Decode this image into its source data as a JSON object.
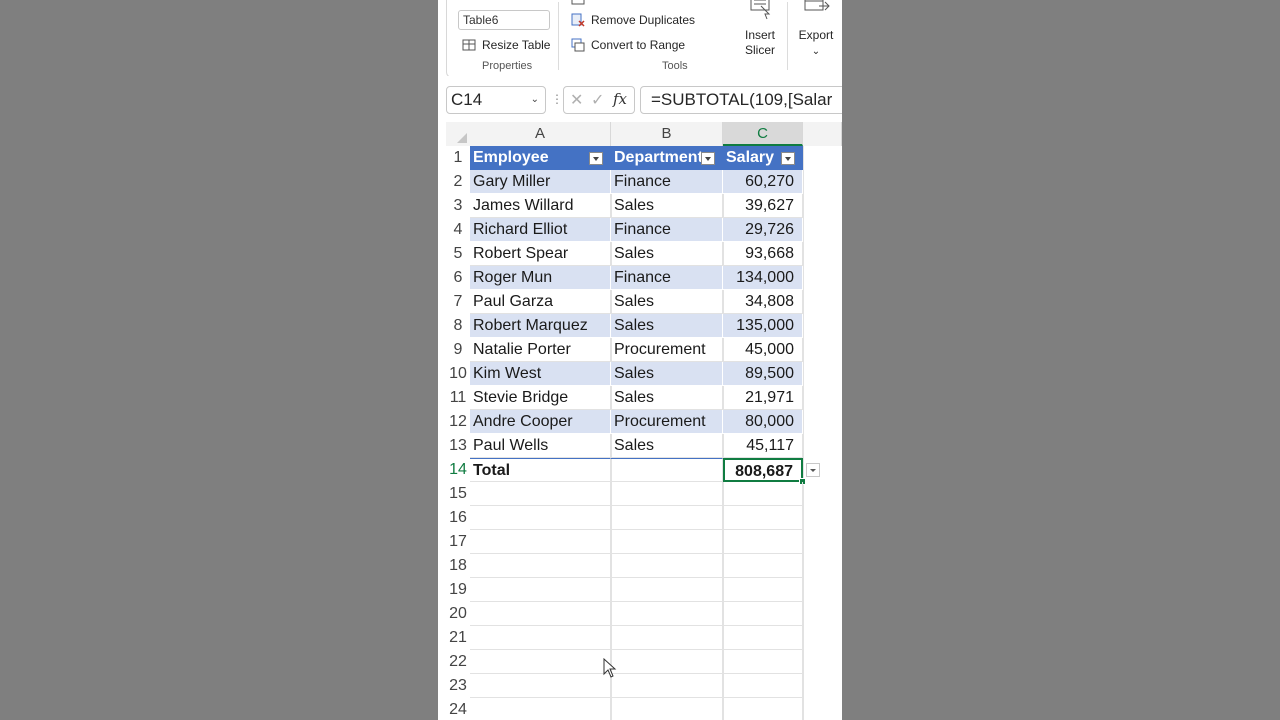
{
  "ribbon": {
    "table_name": "Table6",
    "resize_table": "Resize Table",
    "properties_group": "Properties",
    "remove_duplicates": "Remove Duplicates",
    "convert_to_range": "Convert to Range",
    "tools_group": "Tools",
    "insert_slicer_line1": "Insert",
    "insert_slicer_line2": "Slicer",
    "export_label": "Export",
    "export_caret": "⌄"
  },
  "formula_bar": {
    "name_box": "C14",
    "cancel_glyph": "✕",
    "enter_glyph": "✓",
    "fx_label": "fx",
    "formula": "=SUBTOTAL(109,[Salar"
  },
  "grid": {
    "columns": [
      "A",
      "B",
      "C"
    ],
    "selected_column": "C",
    "row_numbers": [
      "1",
      "2",
      "3",
      "4",
      "5",
      "6",
      "7",
      "8",
      "9",
      "10",
      "11",
      "12",
      "13",
      "14",
      "15",
      "16",
      "17",
      "18",
      "19",
      "20",
      "21",
      "22",
      "23",
      "24"
    ],
    "selected_row": "14",
    "table_headers": [
      "Employee",
      "Department",
      "Salary"
    ],
    "rows": [
      [
        "Gary Miller",
        "Finance",
        "60,270"
      ],
      [
        "James Willard",
        "Sales",
        "39,627"
      ],
      [
        "Richard Elliot",
        "Finance",
        "29,726"
      ],
      [
        "Robert Spear",
        "Sales",
        "93,668"
      ],
      [
        "Roger Mun",
        "Finance",
        "134,000"
      ],
      [
        "Paul Garza",
        "Sales",
        "34,808"
      ],
      [
        "Robert Marquez",
        "Sales",
        "135,000"
      ],
      [
        "Natalie Porter",
        "Procurement",
        "45,000"
      ],
      [
        "Kim West",
        "Sales",
        "89,500"
      ],
      [
        "Stevie Bridge",
        "Sales",
        "21,971"
      ],
      [
        "Andre Cooper",
        "Procurement",
        "80,000"
      ],
      [
        "Paul Wells",
        "Sales",
        "45,117"
      ]
    ],
    "total_label": "Total",
    "total_value": "808,687"
  },
  "colors": {
    "table_header": "#4472c4",
    "band": "#d9e1f2",
    "selection": "#107c41",
    "backdrop": "#7f7f7f"
  }
}
